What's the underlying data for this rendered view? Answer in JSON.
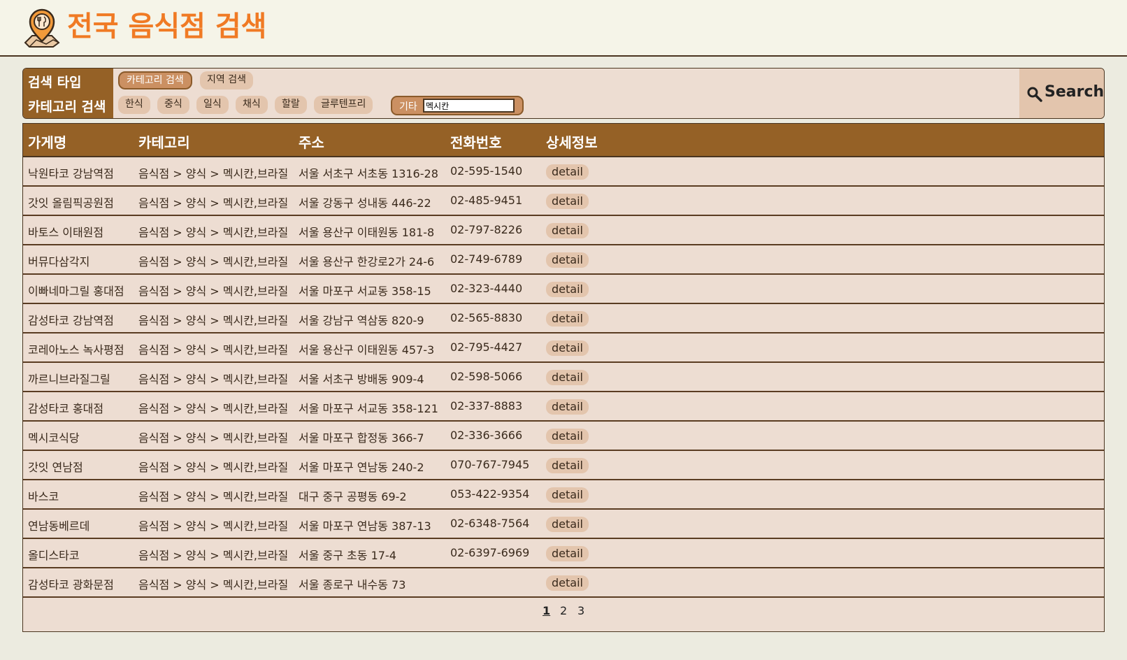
{
  "header": {
    "title": "전국 음식점 검색"
  },
  "search": {
    "type_label": "검색 타입",
    "category_label": "카테고리 검색",
    "types": [
      "카테고리 검색",
      "지역 검색"
    ],
    "active_type": 0,
    "categories": [
      "한식",
      "중식",
      "일식",
      "채식",
      "할랄",
      "글루텐프리"
    ],
    "etc_label": "기타",
    "etc_value": "멕시칸",
    "button_label": "Search"
  },
  "table": {
    "headers": [
      "가게명",
      "카테고리",
      "주소",
      "전화번호",
      "상세정보"
    ],
    "rows": [
      {
        "name": "낙원타코 강남역점",
        "category": "음식점 > 양식 > 멕시칸,브라질",
        "address": "서울 서초구 서초동 1316-28",
        "phone": "02-595-1540",
        "detail": "detail"
      },
      {
        "name": "갓잇 올림픽공원점",
        "category": "음식점 > 양식 > 멕시칸,브라질",
        "address": "서울 강동구 성내동 446-22",
        "phone": "02-485-9451",
        "detail": "detail"
      },
      {
        "name": "바토스 이태원점",
        "category": "음식점 > 양식 > 멕시칸,브라질",
        "address": "서울 용산구 이태원동 181-8",
        "phone": "02-797-8226",
        "detail": "detail"
      },
      {
        "name": "버뮤다삼각지",
        "category": "음식점 > 양식 > 멕시칸,브라질",
        "address": "서울 용산구 한강로2가 24-6",
        "phone": "02-749-6789",
        "detail": "detail"
      },
      {
        "name": "이빠네마그릴 홍대점",
        "category": "음식점 > 양식 > 멕시칸,브라질",
        "address": "서울 마포구 서교동 358-15",
        "phone": "02-323-4440",
        "detail": "detail"
      },
      {
        "name": "감성타코 강남역점",
        "category": "음식점 > 양식 > 멕시칸,브라질",
        "address": "서울 강남구 역삼동 820-9",
        "phone": "02-565-8830",
        "detail": "detail"
      },
      {
        "name": "코레아노스 녹사평점",
        "category": "음식점 > 양식 > 멕시칸,브라질",
        "address": "서울 용산구 이태원동 457-3",
        "phone": "02-795-4427",
        "detail": "detail"
      },
      {
        "name": "까르니브라질그릴",
        "category": "음식점 > 양식 > 멕시칸,브라질",
        "address": "서울 서초구 방배동 909-4",
        "phone": "02-598-5066",
        "detail": "detail"
      },
      {
        "name": "감성타코 홍대점",
        "category": "음식점 > 양식 > 멕시칸,브라질",
        "address": "서울 마포구 서교동 358-121",
        "phone": "02-337-8883",
        "detail": "detail"
      },
      {
        "name": "멕시코식당",
        "category": "음식점 > 양식 > 멕시칸,브라질",
        "address": "서울 마포구 합정동 366-7",
        "phone": "02-336-3666",
        "detail": "detail"
      },
      {
        "name": "갓잇 연남점",
        "category": "음식점 > 양식 > 멕시칸,브라질",
        "address": "서울 마포구 연남동 240-2",
        "phone": "070-767-7945",
        "detail": "detail"
      },
      {
        "name": "바스코",
        "category": "음식점 > 양식 > 멕시칸,브라질",
        "address": "대구 중구 공평동 69-2",
        "phone": "053-422-9354",
        "detail": "detail"
      },
      {
        "name": "연남동베르데",
        "category": "음식점 > 양식 > 멕시칸,브라질",
        "address": "서울 마포구 연남동 387-13",
        "phone": "02-6348-7564",
        "detail": "detail"
      },
      {
        "name": "올디스타코",
        "category": "음식점 > 양식 > 멕시칸,브라질",
        "address": "서울 중구 초동 17-4",
        "phone": "02-6397-6969",
        "detail": "detail"
      },
      {
        "name": "감성타코 광화문점",
        "category": "음식점 > 양식 > 멕시칸,브라질",
        "address": "서울 종로구 내수동 73",
        "phone": "",
        "detail": "detail"
      }
    ]
  },
  "pagination": {
    "pages": [
      "1",
      "2",
      "3"
    ],
    "current": "1"
  },
  "colors": {
    "brand": "#F07A24",
    "header_brown": "#956126",
    "panel_bg": "#EDDDD2",
    "chip_bg": "#E3C5AD",
    "chip_active": "#CB9062"
  },
  "icons": {
    "logo": "map-pin-restaurant-icon",
    "search": "magnifier-icon"
  }
}
